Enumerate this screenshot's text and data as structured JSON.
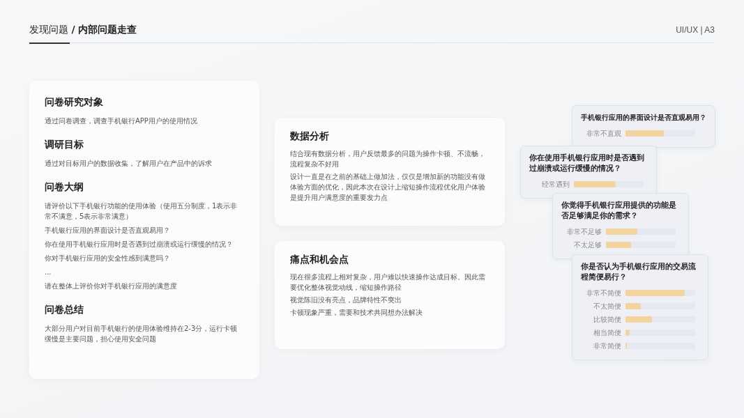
{
  "header": {
    "title": "发现问题 **/ 内部问题走查**",
    "tag": "UI/UX | A3"
  },
  "left_card": {
    "sections": [
      {
        "heading": "问卷研究对象",
        "lines": [
          "通过问卷调查，调查手机银行APP用户的使用情况"
        ]
      },
      {
        "heading": "调研目标",
        "lines": [
          "通过对目标用户的数据收集，了解用户在产品中的诉求"
        ]
      },
      {
        "heading": "问卷大纲",
        "lines": [
          "请评价以下手机银行功能的使用体验（使用五分制度，1表示非常不满意，5表示非常满意）",
          "手机银行应用的界面设计是否直观易用？",
          "你在使用手机银行应用时是否遇到过崩溃或运行缓慢的情况？",
          "你对手机银行应用的安全性感到满意吗？",
          "...",
          "请在整体上评价你对手机银行应用的满意度"
        ]
      },
      {
        "heading": "问卷总结",
        "lines": [
          "大部分用户对目前手机银行的使用体验维持在2-3分，运行卡顿缓慢是主要问题，担心使用安全问题"
        ]
      }
    ]
  },
  "middle_cards": [
    {
      "heading": "数据分析",
      "lines": [
        "结合现有数据分析，用户反馈最多的问题为操作卡顿、不流畅，流程复杂不好用",
        "设计一直是在之前的基础上做加法，仅仅是增加新的功能没有做体验方面的优化，因此本次在设计上缩短操作流程优化用户体验是提升用户满意度的重要发力点"
      ]
    },
    {
      "heading": "痛点和机会点",
      "lines": [
        "现在很多流程上相对复杂，用户难以快速操作达成目标。因此需要优化整体视觉动线，缩短操作路径",
        "视觉陈旧没有亮点，品牌特性不突出",
        "卡顿现象严重，需要和技术共同想办法解决"
      ]
    }
  ],
  "survey_cards": [
    {
      "question": "手机银行应用的界面设计是否直观易用？",
      "rows": [
        {
          "label": "非常不直观",
          "level": 0.55
        }
      ]
    },
    {
      "question": "你在使用手机银行应用时是否遇到过崩溃或运行缓慢的情况？",
      "rows": [
        {
          "label": "经常遇到",
          "level": 0.6
        }
      ]
    },
    {
      "question": "你觉得手机银行应用提供的功能是否足够满足你的需求？",
      "rows": [
        {
          "label": "非常不足够",
          "level": 0.45
        },
        {
          "label": "不太足够",
          "level": 0.36
        }
      ]
    },
    {
      "question": "你是否认为手机银行应用的交易流程简便易行？",
      "rows": [
        {
          "label": "非常不简便",
          "level": 0.85
        },
        {
          "label": "不太简便",
          "level": 0.22
        },
        {
          "label": "比较简便",
          "level": 0.38
        },
        {
          "label": "相当简便",
          "level": 0.06
        },
        {
          "label": "非常简便",
          "level": 0.02
        }
      ]
    }
  ]
}
